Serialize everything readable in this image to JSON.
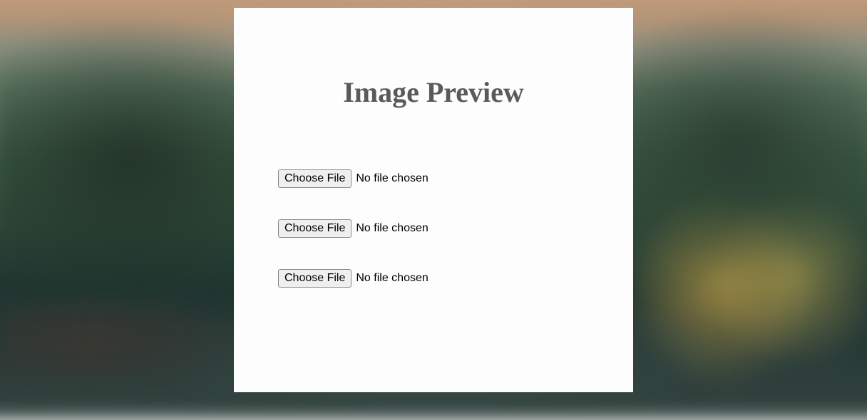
{
  "title": "Image Preview",
  "fileInputs": [
    {
      "buttonLabel": "Choose File",
      "status": "No file chosen"
    },
    {
      "buttonLabel": "Choose File",
      "status": "No file chosen"
    },
    {
      "buttonLabel": "Choose File",
      "status": "No file chosen"
    }
  ]
}
